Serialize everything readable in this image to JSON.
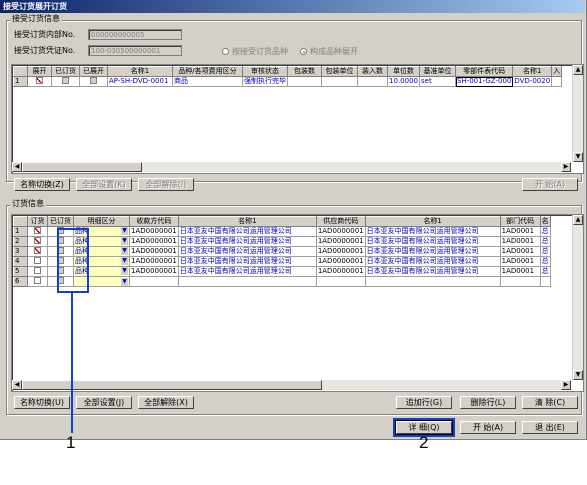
{
  "window": {
    "title": "接受订货展开订货"
  },
  "accept_group": {
    "legend": "接受订货信息",
    "internal_no_label": "接受订货内部No.",
    "internal_no_value": "000000000005",
    "voucher_no_label": "接受订货凭证No.",
    "voucher_no_value": "100-030500000001",
    "radio1": "按接受订货品种",
    "radio2": "构成品种展开"
  },
  "top_grid": {
    "headers": [
      "展开",
      "已订货",
      "已展开",
      "名称1",
      "品种/各项费用区分",
      "审核状态",
      "包装数",
      "包装单位",
      "装入数",
      "单位数",
      "基准单位",
      "零部件表代码",
      "名称1",
      "入"
    ],
    "rows": [
      {
        "no": "1",
        "name1": "AP-SH-DVD-0001",
        "kind": "商品",
        "status": "强制执行完毕",
        "units": "10.0000",
        "base_unit": "set",
        "parts_code": "SH-001-GZ-000",
        "name1b": "DVD-0020"
      }
    ]
  },
  "top_buttons": {
    "toggle": "名称切换(Z)",
    "all_set": "全部设置(K)",
    "all_clear": "全部解除(I)",
    "start": "开 始(A)"
  },
  "order_group": {
    "legend": "订货信息",
    "headers": [
      "订货",
      "已订货",
      "明细区分",
      "收款方代码",
      "名称1",
      "供应商代码",
      "名称1",
      "部门代码",
      "名"
    ],
    "rows": [
      {
        "no": "1",
        "ordered": true,
        "detail": "品种",
        "recv_code": "1AD0000001",
        "name1": "日本亚友中国有限公司运用管理公司",
        "supplier": "1AD0000001",
        "name2": "日本亚友中国有限公司运用管理公司",
        "dept": "1AD0001",
        "n": "总"
      },
      {
        "no": "2",
        "ordered": true,
        "detail": "品种",
        "recv_code": "1AD0000001",
        "name1": "日本亚友中国有限公司运用管理公司",
        "supplier": "1AD0000001",
        "name2": "日本亚友中国有限公司运用管理公司",
        "dept": "1AD0001",
        "n": "总"
      },
      {
        "no": "3",
        "ordered": true,
        "detail": "品种",
        "recv_code": "1AD0000001",
        "name1": "日本亚友中国有限公司运用管理公司",
        "supplier": "1AD0000001",
        "name2": "日本亚友中国有限公司运用管理公司",
        "dept": "1AD0001",
        "n": "总"
      },
      {
        "no": "4",
        "ordered": false,
        "detail": "品种",
        "recv_code": "1AD0000001",
        "name1": "日本亚友中国有限公司运用管理公司",
        "supplier": "1AD0000001",
        "name2": "日本亚友中国有限公司运用管理公司",
        "dept": "1AD0001",
        "n": "总"
      },
      {
        "no": "5",
        "ordered": false,
        "detail": "品种",
        "recv_code": "1AD0000001",
        "name1": "日本亚友中国有限公司运用管理公司",
        "supplier": "1AD0000001",
        "name2": "日本亚友中国有限公司运用管理公司",
        "dept": "1AD0001",
        "n": "总"
      },
      {
        "no": "6",
        "ordered": false,
        "detail": "",
        "recv_code": "",
        "name1": "",
        "supplier": "",
        "name2": "",
        "dept": "",
        "n": ""
      }
    ]
  },
  "bottom_buttons": {
    "toggle": "名称切换(U)",
    "all_set": "全部设置(J)",
    "all_clear": "全部解除(X)",
    "add_row": "追加行(G)",
    "del_row": "删除行(L)",
    "clear": "清 除(C)"
  },
  "footer_buttons": {
    "detail": "详 细(Q)",
    "start": "开 始(A)",
    "exit": "退 出(E)"
  },
  "callouts": {
    "c1": "1",
    "c2": "2"
  },
  "colors": {
    "title_start": "#0a246a",
    "highlight": "#1040d0",
    "blue_text": "#0000c0"
  }
}
